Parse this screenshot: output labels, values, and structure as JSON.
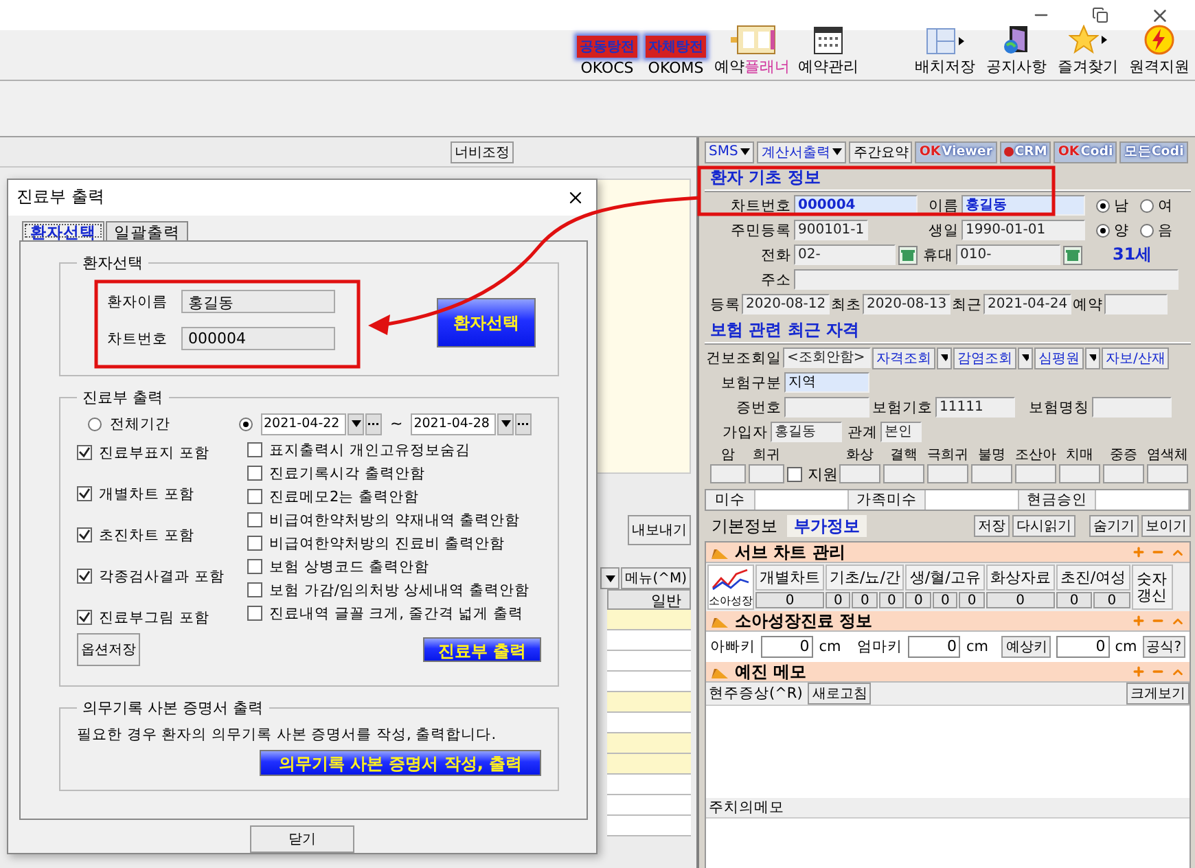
{
  "toolbar": {
    "left_items": [
      {
        "kind": "badge",
        "badge": "공동탕전",
        "label": "OKOCS"
      },
      {
        "kind": "badge",
        "badge": "자체탕전",
        "label": "OKOMS"
      },
      {
        "kind": "planner",
        "label": "예약",
        "label_accent": "플래너"
      },
      {
        "kind": "calendar",
        "label": "예약관리"
      }
    ],
    "right_items": [
      {
        "kind": "layout",
        "label": "배치저장",
        "has_menu": true
      },
      {
        "kind": "notice",
        "label": "공지사항",
        "has_menu": false
      },
      {
        "kind": "star",
        "label": "즐겨찾기",
        "has_menu": true
      },
      {
        "kind": "remote",
        "label": "원격지원",
        "has_menu": false
      }
    ]
  },
  "list_panel": {
    "width_button": "너비조정",
    "export_button": "내보내기",
    "menu_button": "메뉴(^M)",
    "column": "일반",
    "rows": [
      {
        "highlighted": true
      },
      {
        "highlighted": false
      },
      {
        "highlighted": false
      },
      {
        "highlighted": false
      },
      {
        "highlighted": true
      },
      {
        "highlighted": false
      },
      {
        "highlighted": true
      },
      {
        "highlighted": true
      },
      {
        "highlighted": false
      },
      {
        "highlighted": false
      },
      {
        "highlighted": false
      }
    ]
  },
  "patient_panel": {
    "top_buttons": [
      {
        "kind": "dropdown",
        "label": "SMS"
      },
      {
        "kind": "dropdown",
        "label": "계산서출력"
      },
      {
        "kind": "plain",
        "label": "주간요약"
      },
      {
        "kind": "logo",
        "mark": "OK",
        "label": "Viewer"
      },
      {
        "kind": "dot",
        "label": "CRM"
      },
      {
        "kind": "logo",
        "mark": "OK",
        "label": "Codi"
      },
      {
        "kind": "logo",
        "label": "모든Codi"
      }
    ],
    "basic": {
      "title": "환자 기초 정보",
      "chart_no_label": "차트번호",
      "chart_no": "000004",
      "name_label": "이름",
      "name": "홍길동",
      "sex": [
        {
          "label": "남",
          "selected": true
        },
        {
          "label": "여",
          "selected": false
        }
      ],
      "calendar": [
        {
          "label": "양",
          "selected": true
        },
        {
          "label": "음",
          "selected": false
        }
      ],
      "id_label": "주민등록",
      "id": "900101-1",
      "birth_label": "생일",
      "birth": "1990-01-01",
      "phone_label": "전화",
      "phone": "02-",
      "mobile_label": "휴대",
      "mobile": "010-",
      "age": "31세",
      "address_label": "주소",
      "registered_label": "등록",
      "registered": "2020-08-12",
      "first_label": "최초",
      "first": "2020-08-13",
      "last_label": "최근",
      "last": "2021-04-24",
      "reservation_label": "예약"
    },
    "insurance": {
      "title": "보험 관련 최근 자격",
      "query_label": "건보조회일",
      "query": "<조회안함>",
      "buttons": [
        {
          "label": "자격조회",
          "dropdown": true
        },
        {
          "label": "감염조회",
          "dropdown": true
        },
        {
          "label": "심평원",
          "dropdown": true
        },
        {
          "label": "자보/산재",
          "dropdown": false
        }
      ],
      "type_label": "보험구분",
      "type": "지역",
      "card_label": "증번호",
      "code_label": "보험기호",
      "code": "11111",
      "org_label": "보험명칭",
      "holder_label": "가입자",
      "holder": "홍길동",
      "relation_label": "관계",
      "relation": "본인",
      "flags_left": [
        "암",
        "희귀"
      ],
      "support": {
        "label": "지원",
        "checked": false
      },
      "flags_right": [
        "화상",
        "결핵",
        "극희귀",
        "불명",
        "조산아",
        "치매",
        "중증",
        "염색체"
      ]
    },
    "balance": [
      {
        "label": "미수"
      },
      {
        "label": "가족미수"
      },
      {
        "label": "현금승인"
      }
    ],
    "tabs": [
      {
        "label": "기본정보",
        "selected": false
      },
      {
        "label": "부가정보",
        "selected": true
      }
    ],
    "tab_buttons": [
      "저장",
      "다시읽기",
      "숨기기",
      "보이기"
    ],
    "sub_chart": {
      "title": "서브 차트 관리",
      "growth_label": "소아성장",
      "columns": [
        {
          "label": "개별차트",
          "counts": [
            "0"
          ]
        },
        {
          "label": "기초/뇨/간",
          "counts": [
            "0",
            "0",
            "0"
          ]
        },
        {
          "label": "생/혈/고유",
          "counts": [
            "0",
            "0",
            "0"
          ]
        },
        {
          "label": "화상자료",
          "counts": [
            "0"
          ]
        },
        {
          "label": "초진/여성",
          "counts": [
            "0",
            "0"
          ]
        }
      ],
      "refresh_button": "숫자 갱신"
    },
    "growth": {
      "title": "소아성장진료 정보",
      "father_label": "아빠키",
      "father": "0",
      "mother_label": "엄마키",
      "mother": "0",
      "father_unit": "cm",
      "predict_button": "예상키",
      "predicted": "0",
      "predicted_unit": "cm",
      "mother_unit": "cm",
      "formula_button": "공식?"
    },
    "memo": {
      "title": "예진 메모",
      "symptom_label": "현주증상(^R)",
      "refresh_button": "새로고침",
      "enlarge_button": "크게보기",
      "doctor_label": "주치의메모"
    }
  },
  "dialog": {
    "title": "진료부 출력",
    "tabs": [
      {
        "label": "환자선택",
        "selected": true
      },
      {
        "label": "일괄출력",
        "selected": false
      }
    ],
    "patient_group": {
      "title": "환자선택",
      "name_label": "환자이름",
      "name": "홍길동",
      "chart_label": "차트번호",
      "chart": "000004",
      "select_button": "환자선택"
    },
    "output_group": {
      "title": "진료부 출력",
      "period": [
        {
          "label": "전체기간",
          "selected": false
        },
        {
          "selected": true
        }
      ],
      "from": "2021-04-22",
      "tilde": "~",
      "to": "2021-04-28",
      "left_options": [
        {
          "label": "진료부표지 포함",
          "checked": true
        },
        {
          "label": "개별차트 포함",
          "checked": true
        },
        {
          "label": "초진차트 포함",
          "checked": true
        },
        {
          "label": "각종검사결과 포함",
          "checked": true
        },
        {
          "label": "진료부그림 포함",
          "checked": true
        }
      ],
      "right_options": [
        {
          "label": "표지출력시 개인고유정보숨김",
          "checked": false
        },
        {
          "label": "진료기록시각 출력안함",
          "checked": false
        },
        {
          "label": "진료메모2는 출력안함",
          "checked": false
        },
        {
          "label": "비급여한약처방의 약재내역 출력안함",
          "checked": false
        },
        {
          "label": "비급여한약처방의 진료비 출력안함",
          "checked": false
        },
        {
          "label": "보험 상병코드 출력안함",
          "checked": false
        },
        {
          "label": "보험 가감/임의처방 상세내역 출력안함",
          "checked": false
        },
        {
          "label": "진료내역 글꼴 크게, 줄간격 넓게 출력",
          "checked": false
        }
      ],
      "save_button": "옵션저장",
      "print_button": "진료부 출력"
    },
    "certificate_group": {
      "title": "의무기록 사본 증명서 출력",
      "text": "필요한 경우 환자의 의무기록 사본 증명서를 작성, 출력합니다.",
      "button": "의무기록 사본 증명서 작성, 출력"
    },
    "close_button": "닫기"
  }
}
